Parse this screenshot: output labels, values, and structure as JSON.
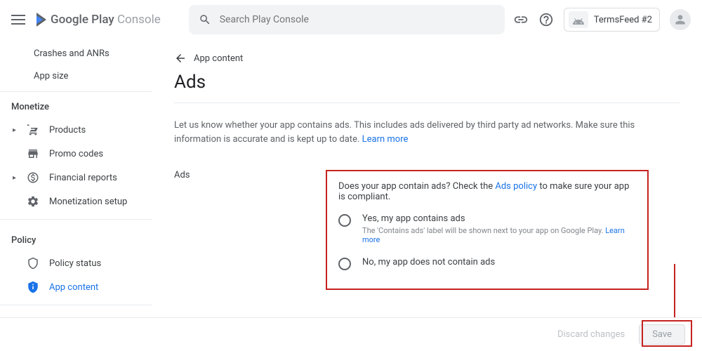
{
  "header": {
    "logo_main": "Google Play",
    "logo_sub": " Console",
    "search_placeholder": "Search Play Console",
    "account_name": "TermsFeed #2"
  },
  "sidebar": {
    "top": [
      "Crashes and ANRs",
      "App size"
    ],
    "monetize_label": "Monetize",
    "monetize_items": [
      "Products",
      "Promo codes",
      "Financial reports",
      "Monetization setup"
    ],
    "policy_label": "Policy",
    "policy_items": [
      "Policy status",
      "App content"
    ]
  },
  "main": {
    "back_label": "App content",
    "title": "Ads",
    "desc_pre": "Let us know whether your app contains ads. This includes ads delivered by third party ad networks. Make sure this information is accurate and is kept up to date. ",
    "learn_more": "Learn more",
    "section_label": "Ads",
    "question_pre": "Does your app contain ads? Check the ",
    "ads_policy": "Ads policy",
    "question_post": " to make sure your app is compliant.",
    "opt1_label": "Yes, my app contains ads",
    "opt1_sub_pre": "The 'Contains ads' label will be shown next to your app on Google Play. ",
    "opt2_label": "No, my app does not contain ads"
  },
  "footer": {
    "discard": "Discard changes",
    "save": "Save"
  }
}
